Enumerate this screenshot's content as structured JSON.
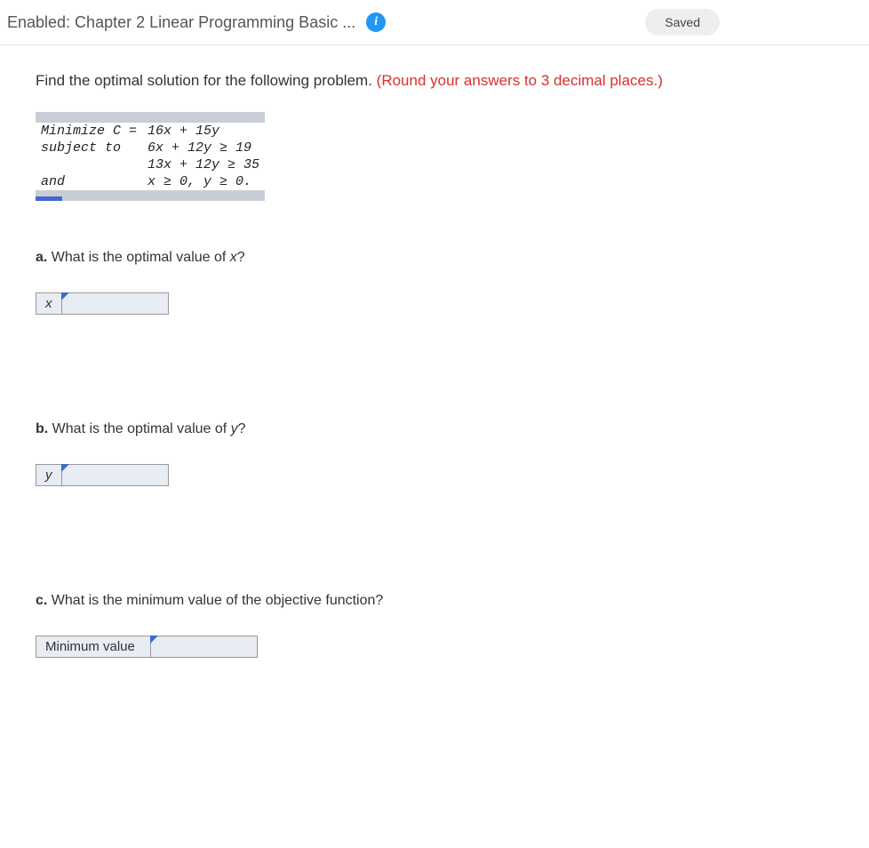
{
  "header": {
    "title": "Enabled: Chapter 2 Linear Programming Basic ...",
    "info_icon": "i",
    "saved_label": "Saved"
  },
  "intro": {
    "text_black": "Find the optimal solution for the following problem. ",
    "text_red": "(Round your answers to 3 decimal places.)"
  },
  "problem": {
    "r1c1": "Minimize C =",
    "r1c2": "16x + 15y",
    "r2c1": "subject to",
    "r2c2": "6x + 12y ≥ 19",
    "r3c1": "",
    "r3c2": "13x + 12y ≥ 35",
    "r4c1": "and",
    "r4c2": "x ≥ 0, y ≥ 0."
  },
  "questions": {
    "a": {
      "label_bold": "a.",
      "label_text": " What is the optimal value of ",
      "var": "x",
      "q": "?",
      "field_label": "x",
      "value": ""
    },
    "b": {
      "label_bold": "b.",
      "label_text": " What is the optimal value of ",
      "var": "y",
      "q": "?",
      "field_label": "y",
      "value": ""
    },
    "c": {
      "label_bold": "c.",
      "label_text": " What is the minimum value of the objective function?",
      "field_label": "Minimum value",
      "value": ""
    }
  }
}
